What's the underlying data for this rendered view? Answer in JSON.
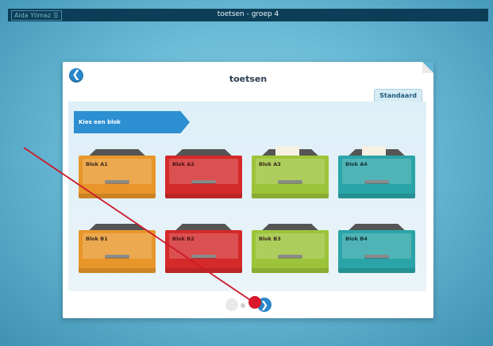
{
  "topbar": {
    "user_label": "Aida Yilmaz ☰",
    "window_title": "toetsen - groep 4"
  },
  "card": {
    "title": "toetsen",
    "back_icon": "arrow-left-icon",
    "tab_label": "Standaard"
  },
  "ribbon": {
    "label": "Kies een blok"
  },
  "blocks": [
    {
      "label": "Blok A1",
      "color": "#e8962a"
    },
    {
      "label": "Blok A2",
      "color": "#d42a2a"
    },
    {
      "label": "Blok A3",
      "color": "#9cc43a"
    },
    {
      "label": "Blok A4",
      "color": "#2aa4a8"
    },
    {
      "label": "Blok B1",
      "color": "#e8962a"
    },
    {
      "label": "Blok B2",
      "color": "#d42a2a"
    },
    {
      "label": "Blok B3",
      "color": "#9cc43a"
    },
    {
      "label": "Blok B4",
      "color": "#2aa4a8"
    }
  ],
  "pager": {
    "next_icon": "chevron-right-icon"
  },
  "colors": {
    "accent": "#2a87c9",
    "topbar": "#0c3f57",
    "annotation": "#cc1a2a"
  }
}
